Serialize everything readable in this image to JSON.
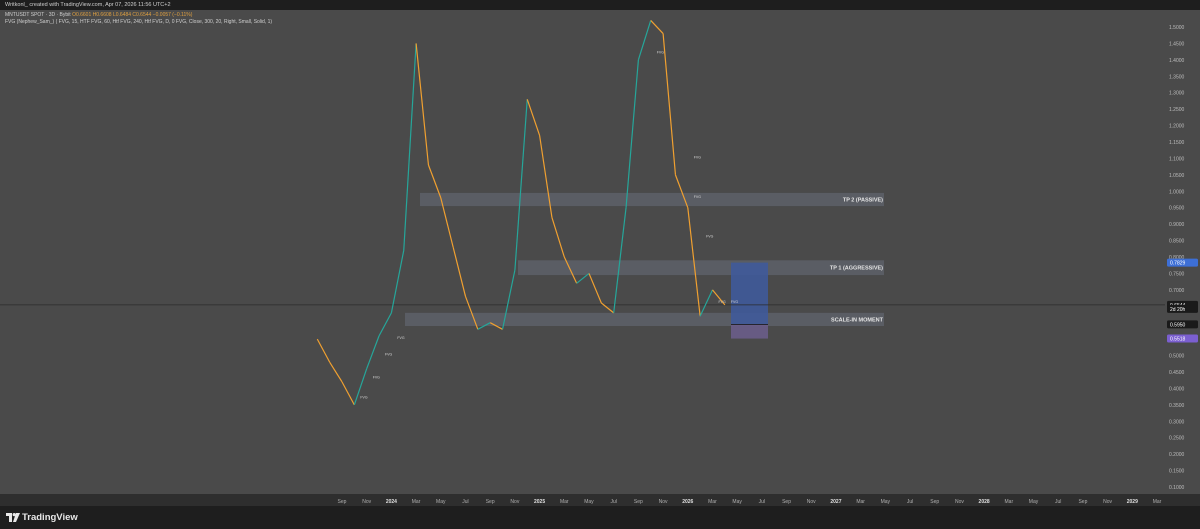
{
  "header": {
    "title": "Writkonl_ created with TradingView.com, Apr 07, 2026 11:56 UTC+2"
  },
  "legend": {
    "symbol": "MNTUSDT SPOT · 3D · Bybit",
    "ohlc": {
      "O": "O0.6601",
      "H": "H0.6608",
      "L": "L0.6484",
      "C": "C0.6544",
      "chg": "−0.0057 (−0.11%)"
    },
    "indicator": "FVG (Nephew_Sam_) ( FVG, 15, HTF FVG, 60, Htf FVG, 240, Htf FVG, D, 0 FVG, Close, 300, 20, Right, Small, Solid, 1)"
  },
  "footer": {
    "brand": "TradingView"
  },
  "chart_data": {
    "type": "line",
    "title": "",
    "xlabel": "",
    "ylabel": "",
    "ylim": [
      0.1,
      1.55
    ],
    "y_ticks": [
      "1.5000",
      "1.4500",
      "1.4000",
      "1.3500",
      "1.3000",
      "1.2500",
      "1.2000",
      "1.1500",
      "1.1000",
      "1.0500",
      "1.0000",
      "0.9500",
      "0.9000",
      "0.8500",
      "0.8000",
      "0.7500",
      "0.7000",
      "0.6500",
      "0.6000",
      "0.5500",
      "0.5000",
      "0.4500",
      "0.4000",
      "0.3500",
      "0.3000",
      "0.2500",
      "0.2000",
      "0.1500",
      "0.1000"
    ],
    "x_ticks": [
      "Sep",
      "Nov",
      "2024",
      "Mar",
      "May",
      "Jul",
      "Sep",
      "Nov",
      "2025",
      "Mar",
      "May",
      "Jul",
      "Sep",
      "Nov",
      "2026",
      "Mar",
      "May",
      "Jul",
      "Sep",
      "Nov",
      "2027",
      "Mar",
      "May",
      "Jul",
      "Sep",
      "Nov",
      "2028",
      "Mar",
      "May",
      "Jul",
      "Sep",
      "Nov",
      "2029",
      "Mar"
    ],
    "price_series": [
      {
        "date": "2023-07",
        "price": 0.55
      },
      {
        "date": "2023-08",
        "price": 0.48
      },
      {
        "date": "2023-09",
        "price": 0.42
      },
      {
        "date": "2023-10",
        "price": 0.35
      },
      {
        "date": "2023-11",
        "price": 0.46
      },
      {
        "date": "2023-12",
        "price": 0.56
      },
      {
        "date": "2024-01",
        "price": 0.63
      },
      {
        "date": "2024-02",
        "price": 0.82
      },
      {
        "date": "2024-03",
        "price": 1.45
      },
      {
        "date": "2024-04",
        "price": 1.08
      },
      {
        "date": "2024-05",
        "price": 0.98
      },
      {
        "date": "2024-06",
        "price": 0.83
      },
      {
        "date": "2024-07",
        "price": 0.68
      },
      {
        "date": "2024-08",
        "price": 0.58
      },
      {
        "date": "2024-09",
        "price": 0.6
      },
      {
        "date": "2024-10",
        "price": 0.58
      },
      {
        "date": "2024-11",
        "price": 0.76
      },
      {
        "date": "2024-12",
        "price": 1.28
      },
      {
        "date": "2025-01",
        "price": 1.17
      },
      {
        "date": "2025-02",
        "price": 0.92
      },
      {
        "date": "2025-03",
        "price": 0.8
      },
      {
        "date": "2025-04",
        "price": 0.72
      },
      {
        "date": "2025-05",
        "price": 0.75
      },
      {
        "date": "2025-06",
        "price": 0.66
      },
      {
        "date": "2025-07",
        "price": 0.63
      },
      {
        "date": "2025-08",
        "price": 0.95
      },
      {
        "date": "2025-09",
        "price": 1.4
      },
      {
        "date": "2025-10",
        "price": 1.52
      },
      {
        "date": "2025-11",
        "price": 1.48
      },
      {
        "date": "2025-12",
        "price": 1.05
      },
      {
        "date": "2026-01",
        "price": 0.95
      },
      {
        "date": "2026-02",
        "price": 0.62
      },
      {
        "date": "2026-03",
        "price": 0.7
      },
      {
        "date": "2026-04",
        "price": 0.6544
      }
    ],
    "zones": [
      {
        "label": "TP 2 (PASSIVE)",
        "from": 0.955,
        "to": 0.995
      },
      {
        "label": "TP 1 (AGGRESSIVE)",
        "from": 0.745,
        "to": 0.79
      },
      {
        "label": "SCALE-IN MOMENT",
        "from": 0.59,
        "to": 0.63
      }
    ],
    "position_box": {
      "entry": 0.595,
      "target": 0.7829,
      "stop": 0.5518
    },
    "price_labels": [
      {
        "text": "0.7829",
        "value": 0.7829,
        "color": "#3d6fd6"
      },
      {
        "text": "0.6544",
        "value": 0.6544,
        "color": "#1a1a1a"
      },
      {
        "text": "2d 20h",
        "value": 0.642,
        "color": "#1a1a1a"
      },
      {
        "text": "0.5950",
        "value": 0.595,
        "color": "#1a1a1a"
      },
      {
        "text": "0.5518",
        "value": 0.5518,
        "color": "#7b5fd0"
      }
    ],
    "last_price": 0.6544,
    "fvg_label": "FVG",
    "colors": {
      "bull": "#26a69a",
      "bear": "#f0a030",
      "zone": "#5d6068",
      "box_profit": "#3f5a9a",
      "box_loss": "#6a5d8a"
    }
  }
}
